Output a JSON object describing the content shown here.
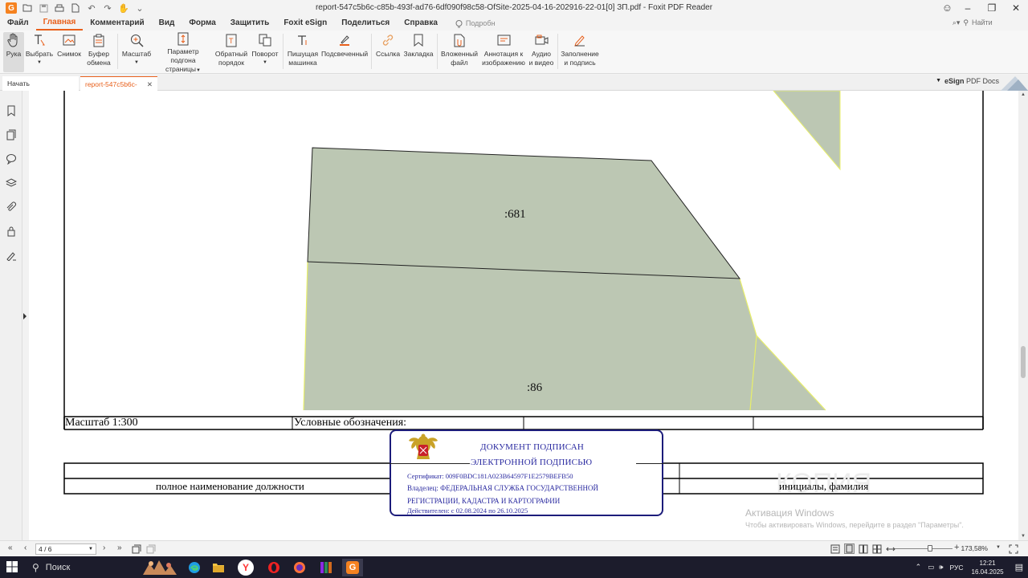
{
  "window": {
    "title": "report-547c5b6c-c85b-493f-ad76-6df090f98c58-OfSite-2025-04-16-202916-22-01[0] ЗП.pdf - Foxit PDF Reader",
    "app_logo": "G"
  },
  "menu": {
    "items": [
      "Файл",
      "Главная",
      "Комментарий",
      "Вид",
      "Форма",
      "Защитить",
      "Foxit eSign",
      "Поделиться",
      "Справка"
    ],
    "active": "Главная",
    "tell_me": "Подробн",
    "find_placeholder": "Найти"
  },
  "ribbon": {
    "hand": [
      "Рука"
    ],
    "select": [
      "Выбрать"
    ],
    "snapshot": [
      "Снимок"
    ],
    "clipboard": [
      "Буфер",
      "обмена"
    ],
    "zoom": [
      "Масштаб"
    ],
    "page_fit": [
      "Параметр подгона",
      "страницы"
    ],
    "reverse_view": [
      "Обратный",
      "порядок"
    ],
    "rotate": [
      "Поворот"
    ],
    "typewriter": [
      "Пишущая",
      "машинка"
    ],
    "highlight": [
      "Подсвеченный"
    ],
    "link": [
      "Ссылка"
    ],
    "bookmark": [
      "Закладка"
    ],
    "attach": [
      "Вложенный",
      "файл"
    ],
    "image_annot": [
      "Аннотация к",
      "изображению"
    ],
    "av": [
      "Аудио",
      "и видео"
    ],
    "fill_sign": [
      "Заполнение",
      "и подпись"
    ]
  },
  "tabs": {
    "start": "Начать",
    "document": "report-547c5b6c-c85...",
    "esign_brand": "eSign",
    "esign_suffix": "PDF Docs"
  },
  "map": {
    "parcel_top_label": ":681",
    "parcel_bottom_label": ":86",
    "fill_color": "#bcc7b3",
    "edge_color": "#e8ef6a"
  },
  "document": {
    "scale_label": "Масштаб 1:300",
    "legend_label": "Условные обозначения:",
    "position_label": "полное наименование должности",
    "initials_label": "инициалы, фамилия"
  },
  "signature": {
    "line1": "ДОКУМЕНТ ПОДПИСАН",
    "line2": "ЭЛЕКТРОННОЙ ПОДПИСЬЮ",
    "certificate": "Сертификат: 009F0BDC181A023B64597F1E2579BEFB50",
    "owner1": "Владелец: ФЕДЕРАЛЬНАЯ СЛУЖБА ГОСУДАРСТВЕННОЙ",
    "owner2": "РЕГИСТРАЦИИ, КАДАСТРА И КАРТОГРАФИИ",
    "valid": "Действителен: с 02.08.2024 по 26.10.2025",
    "border_color": "#1c1c7a",
    "text_color": "#2a2aa0"
  },
  "watermark": {
    "line1": "Активация Windows",
    "line2": "Чтобы активировать Windows, перейдите в раздел \"Параметры\"."
  },
  "status": {
    "page": "4 / 6",
    "zoom": "173,58%"
  },
  "taskbar": {
    "search": "Поиск",
    "lang": "РУС",
    "time": "12:21",
    "date": "16.04.2025"
  }
}
